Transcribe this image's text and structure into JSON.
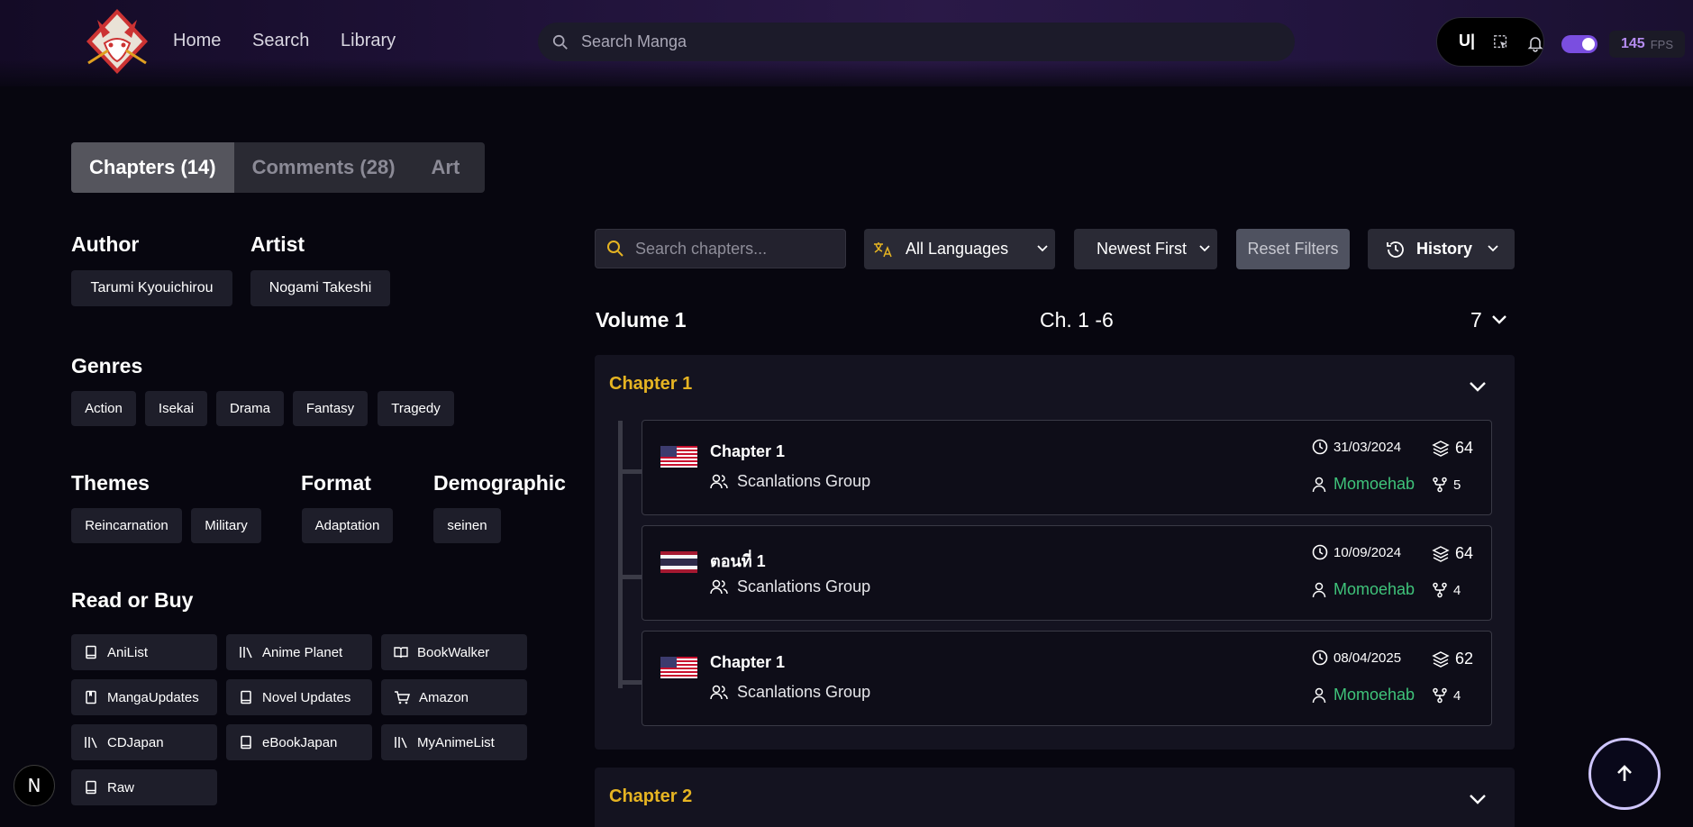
{
  "header": {
    "nav": [
      "Home",
      "Search",
      "Library"
    ],
    "search_placeholder": "Search Manga",
    "fps_value": "145",
    "fps_unit": "FPS",
    "ui_label": "U|"
  },
  "tabs": [
    "Chapters (14)",
    "Comments (28)",
    "Art"
  ],
  "sidebar": {
    "author_heading": "Author",
    "author": "Tarumi Kyouichirou",
    "artist_heading": "Artist",
    "artist": "Nogami Takeshi",
    "genres_heading": "Genres",
    "genres": [
      "Action",
      "Isekai",
      "Drama",
      "Fantasy",
      "Tragedy"
    ],
    "themes_heading": "Themes",
    "themes": [
      "Reincarnation",
      "Military"
    ],
    "format_heading": "Format",
    "format": [
      "Adaptation"
    ],
    "demographic_heading": "Demographic",
    "demographic": [
      "seinen"
    ],
    "read_heading": "Read or Buy",
    "links": [
      "AniList",
      "Anime Planet",
      "BookWalker",
      "MangaUpdates",
      "Novel Updates",
      "Amazon",
      "CDJapan",
      "eBookJapan",
      "MyAnimeList",
      "Raw"
    ]
  },
  "filters": {
    "search_placeholder": "Search chapters...",
    "language": "All Languages",
    "sort": "Newest First",
    "reset": "Reset Filters",
    "history": "History"
  },
  "volume": {
    "title": "Volume 1",
    "range": "Ch. 1 -6",
    "count": "7"
  },
  "chapters": [
    {
      "title": "Chapter 1",
      "entries": [
        {
          "flag": "us",
          "name": "Chapter 1",
          "group": "Scanlations Group",
          "date": "31/03/2024",
          "pages": "64",
          "user": "Momoehab",
          "forks": "5"
        },
        {
          "flag": "th",
          "name": "ตอนที่ 1",
          "group": "Scanlations Group",
          "date": "10/09/2024",
          "pages": "64",
          "user": "Momoehab",
          "forks": "4"
        },
        {
          "flag": "us",
          "name": "Chapter 1",
          "group": "Scanlations Group",
          "date": "08/04/2025",
          "pages": "62",
          "user": "Momoehab",
          "forks": "4"
        }
      ]
    },
    {
      "title": "Chapter 2"
    }
  ],
  "colors": {
    "accent": "#e6b422",
    "user": "#3fc37a",
    "toggle": "#7a4ee0"
  },
  "misc": {
    "next_badge": "N"
  }
}
